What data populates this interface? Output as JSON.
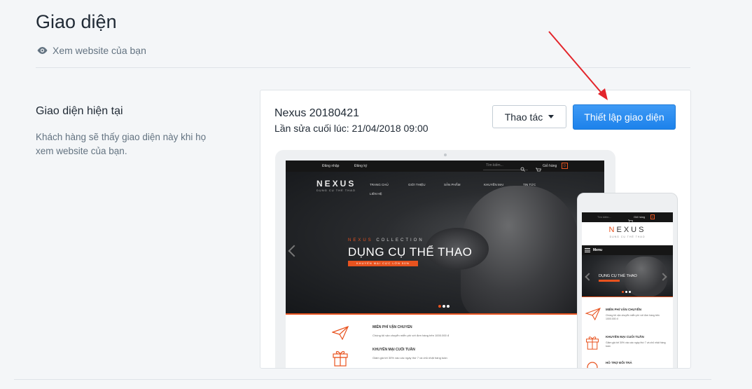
{
  "header": {
    "title": "Giao diện",
    "view_link": "Xem website của bạn"
  },
  "section": {
    "title": "Giao diện hiện tại",
    "description": "Khách hàng sẽ thấy giao diện này khi họ xem website của bạn."
  },
  "theme": {
    "name": "Nexus 20180421",
    "last_edited": "Lần sửa cuối lúc: 21/04/2018 09:00",
    "actions_label": "Thao tác",
    "setup_label": "Thiết lập giao diện",
    "accent_color": "#1d82eb"
  },
  "preview": {
    "brand_color": "#e8531f",
    "desktop": {
      "login": "Đăng nhập",
      "register": "Đăng ký",
      "search_placeholder": "Tìm kiếm...",
      "cart": "Giỏ hàng",
      "cart_count": "0",
      "logo": "NEXUS",
      "logo_sub": "DỤNG CỤ THỂ THAO",
      "nav": [
        "TRANG CHỦ",
        "GIỚI THIỆU",
        "SẢN PHẨM",
        "KHUYẾN MẠI",
        "TIN TỨC",
        "LIÊN HỆ"
      ],
      "collection_brand": "NEXUS",
      "collection_label": "COLLECTION",
      "headline": "DỤNG CỤ THỂ THAO",
      "promo": "KHUYẾN MẠI CỰC LỚN 50%",
      "features": [
        {
          "title": "MIỄN PHÍ VẬN CHUYỂN",
          "text": "Chúng tôi vận chuyển miễn phí với đơn hàng trên 1000.000 đ",
          "icon": "paper-plane-icon"
        },
        {
          "title": "KHUYẾN MẠI CUỐI TUẦN",
          "text": "Giảm giá tới 30% vào các ngày thứ 7 và chủ nhật hàng tuần",
          "icon": "gift-icon"
        }
      ]
    },
    "mobile": {
      "search_placeholder": "Tìm kiếm...",
      "cart": "Giỏ hàng",
      "cart_count": "0",
      "logo_first": "N",
      "logo_rest": "EXUS",
      "logo_sub": "DỤNG CỤ THỂ THAO",
      "menu": "Menu",
      "headline": "DỤNG CỤ THỂ THAO",
      "features": [
        {
          "title": "MIỄN PHÍ VẬN CHUYỂN",
          "text": "Chúng tôi vận chuyển miễn phí với đơn hàng trên 1000.000 đ",
          "icon": "paper-plane-icon"
        },
        {
          "title": "KHUYẾN MẠI CUỐI TUẦN",
          "text": "Giảm giá tới 30% vào các ngày thứ 7 và chủ nhật hàng tuần",
          "icon": "gift-icon"
        },
        {
          "title": "HỖ TRỢ ĐỔI TRẢ",
          "text": "",
          "icon": "return-icon"
        }
      ]
    }
  }
}
